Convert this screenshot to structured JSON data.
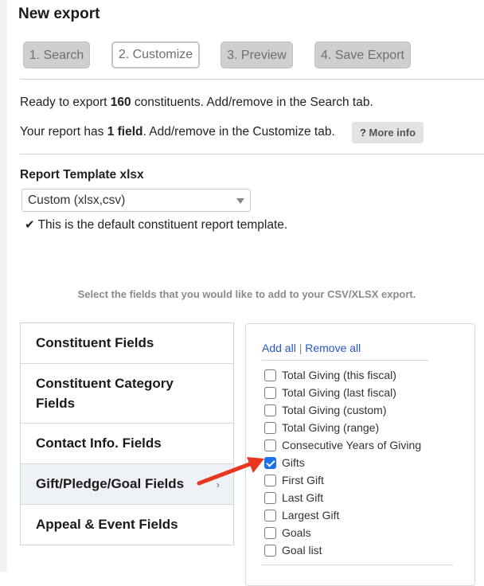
{
  "page": {
    "title": "New export"
  },
  "steps": [
    {
      "label": "1. Search",
      "state": "inactive"
    },
    {
      "label": "2. Customize",
      "state": "active"
    },
    {
      "label": "3. Preview",
      "state": "inactive"
    },
    {
      "label": "4. Save Export",
      "state": "inactive"
    }
  ],
  "summary": {
    "export_prefix": "Ready to export ",
    "export_count": "160",
    "export_suffix": " constituents. Add/remove in the Search tab.",
    "report_prefix": "Your report has ",
    "report_count": "1 field",
    "report_suffix": ". Add/remove in the Customize tab.",
    "more_info_label": "More info",
    "more_info_icon": "?"
  },
  "template": {
    "label": "Report Template xlsx",
    "selected": "Custom (xlsx,csv)",
    "default_note": "This is the default constituent report template.",
    "check_icon": "✔"
  },
  "fields_hint": "Select the fields that you would like to add to your CSV/XLSX export.",
  "categories": [
    {
      "label": "Constituent Fields",
      "selected": false
    },
    {
      "label": "Constituent Category Fields",
      "selected": false
    },
    {
      "label": "Contact Info. Fields",
      "selected": false
    },
    {
      "label": "Gift/Pledge/Goal Fields",
      "selected": true
    },
    {
      "label": "Appeal & Event Fields",
      "selected": false
    }
  ],
  "field_panel": {
    "add_all": "Add all",
    "separator": "|",
    "remove_all": "Remove all",
    "items": [
      {
        "label": "Total Giving (this fiscal)",
        "checked": false
      },
      {
        "label": "Total Giving (last fiscal)",
        "checked": false
      },
      {
        "label": "Total Giving (custom)",
        "checked": false
      },
      {
        "label": "Total Giving (range)",
        "checked": false
      },
      {
        "label": "Consecutive Years of Giving",
        "checked": false
      },
      {
        "label": "Gifts",
        "checked": true
      },
      {
        "label": "First Gift",
        "checked": false
      },
      {
        "label": "Last Gift",
        "checked": false
      },
      {
        "label": "Largest Gift",
        "checked": false
      },
      {
        "label": "Goals",
        "checked": false
      },
      {
        "label": "Goal list",
        "checked": false
      }
    ]
  },
  "colors": {
    "accent_blue": "#1a73e8",
    "link_blue": "#2a55c8",
    "annotation_arrow": "#e8361f",
    "step_inactive_bg": "#cfcfcf"
  }
}
